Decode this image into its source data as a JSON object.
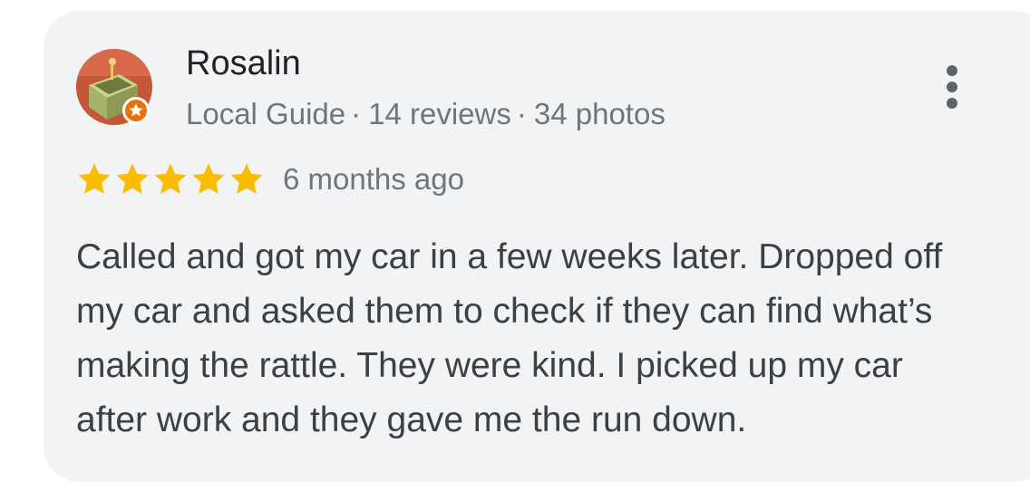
{
  "reviewer": {
    "name": "Rosalin",
    "badge": "Local Guide",
    "reviews_count": "14 reviews",
    "photos_count": "34 photos",
    "separator": "·"
  },
  "rating": {
    "stars": 5,
    "max_stars": 5,
    "time_ago": "6 months ago",
    "star_color": "#fbbc04"
  },
  "review_text": "Called and got my car in a few weeks later. Dropped off my car and asked them to check if they can find what’s making the rattle. They were kind. I picked up my car after work and they gave me the run down.",
  "icons": {
    "avatar": "avatar-box-photo",
    "guide_badge": "local-guide-star-icon",
    "menu": "more-vert-icon"
  }
}
